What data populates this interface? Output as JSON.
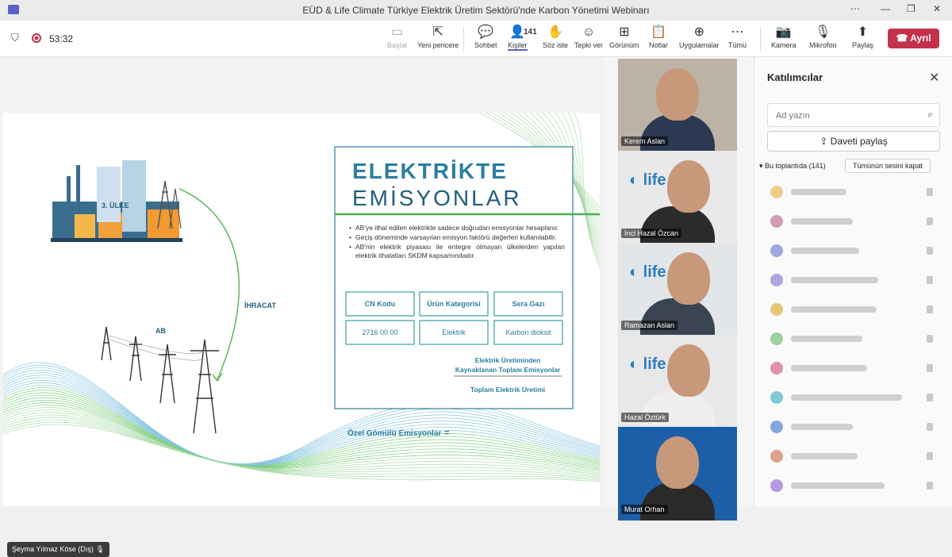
{
  "app": {
    "title": "EÜD & Life Climate Türkiye Elektrik Üretim Sektörü'nde Karbon Yönetimi Webinarı"
  },
  "window_controls": [
    "⋯",
    "—",
    "❐",
    "✕"
  ],
  "meeting": {
    "timer": "53:32"
  },
  "toolbar": {
    "items": [
      {
        "label": "Başlat",
        "icon": "share-screen-icon",
        "glyph": "▭",
        "disabled": true
      },
      {
        "label": "Yeni pencere",
        "icon": "new-window-icon",
        "glyph": "⇱"
      },
      {
        "label": "Sohbet",
        "icon": "chat-icon",
        "glyph": "💬"
      },
      {
        "label": "Kişiler",
        "icon": "people-icon",
        "glyph": "👤",
        "count": "141"
      },
      {
        "label": "Söz iste",
        "icon": "raise-hand-icon",
        "glyph": "✋"
      },
      {
        "label": "Tepki ver",
        "icon": "react-icon",
        "glyph": "☺"
      },
      {
        "label": "Görünüm",
        "icon": "view-icon",
        "glyph": "⊞"
      },
      {
        "label": "Notlar",
        "icon": "notes-icon",
        "glyph": "📋"
      },
      {
        "label": "Uygulamalar",
        "icon": "apps-icon",
        "glyph": "⊕"
      },
      {
        "label": "Tümü",
        "icon": "more-icon",
        "glyph": "⋯"
      },
      {
        "label": "Kamera",
        "icon": "camera-off-icon",
        "glyph": "📷"
      },
      {
        "label": "Mikrofon",
        "icon": "mic-off-icon",
        "glyph": "🎙"
      },
      {
        "label": "Paylaş",
        "icon": "share-icon",
        "glyph": "⬆"
      }
    ],
    "leave_label": "Ayrıl"
  },
  "slide": {
    "country_label": "3. ÜLKE",
    "export_label": "İHRACAT",
    "eu_label": "AB",
    "title_line1": "ELEKTRİKTE",
    "title_line2": "EMİSYONLAR",
    "bullets": [
      "AB'ye ithal edilen elektrikte sadece doğrudan emisyonlar hesaplanır.",
      "Geçiş döneminde varsayılan emisyon faktörü değerleri kullanılabilir.",
      "AB'nin elektrik piyasası ile entegre olmayan ülkelerden yapılan elektrik ithalatları SKDM kapsamındadır."
    ],
    "table_headers": [
      "CN Kodu",
      "Ürün Kategorisi",
      "Sera Gazı"
    ],
    "table_values": [
      "2716 00 00",
      "Elektrik",
      "Karbon dioksit"
    ],
    "formula_left": "Özel Gömülü Emisyonlar",
    "formula_eq": "=",
    "formula_num": "Elektrik Üretiminden Kaynaklanan Toplam Emisyonlar",
    "formula_den": "Toplam Elektrik Üretimi"
  },
  "participants_video": [
    {
      "name": "Kerem Aslan",
      "bg": "#bdb2a6",
      "shirt": "#2b3a52",
      "logo": ""
    },
    {
      "name": "İnci Hazal Özcan",
      "bg": "#e9e9e9",
      "shirt": "#2b2b2b",
      "logo": "life"
    },
    {
      "name": "Ramazan Aslan",
      "bg": "#e3e6e8",
      "shirt": "#3a4452",
      "logo": "life"
    },
    {
      "name": "Hazal Öztürk",
      "bg": "#e8e8e8",
      "shirt": "#efefef",
      "logo": "life"
    },
    {
      "name": "Murat Orhan",
      "bg": "#1c5fa8",
      "shirt": "#2a2a2a",
      "logo": ""
    }
  ],
  "panel": {
    "title": "Katılımcılar",
    "search_placeholder": "Ad yazın",
    "share_invite": "Daveti paylaş",
    "section": "Bu toplantıda (141)",
    "mute_all": "Tümünün sesini kapat",
    "rows": [
      {
        "color": "#e3a82b",
        "bar": 70
      },
      {
        "color": "#b04a7a",
        "bar": 78
      },
      {
        "color": "#5b5fc7",
        "bar": 86
      },
      {
        "color": "#6b5fc7",
        "bar": 110
      },
      {
        "color": "#d19a10",
        "bar": 108
      },
      {
        "color": "#4caf50",
        "bar": 90
      },
      {
        "color": "#c43a6a",
        "bar": 96
      },
      {
        "color": "#1aa3b3",
        "bar": 140
      },
      {
        "color": "#2060c7",
        "bar": 78
      },
      {
        "color": "#c7552f",
        "bar": 84
      },
      {
        "color": "#7a4ac7",
        "bar": 118
      }
    ]
  },
  "presenter": {
    "name": "Şeyma Yılmaz Köse (Dış)"
  }
}
